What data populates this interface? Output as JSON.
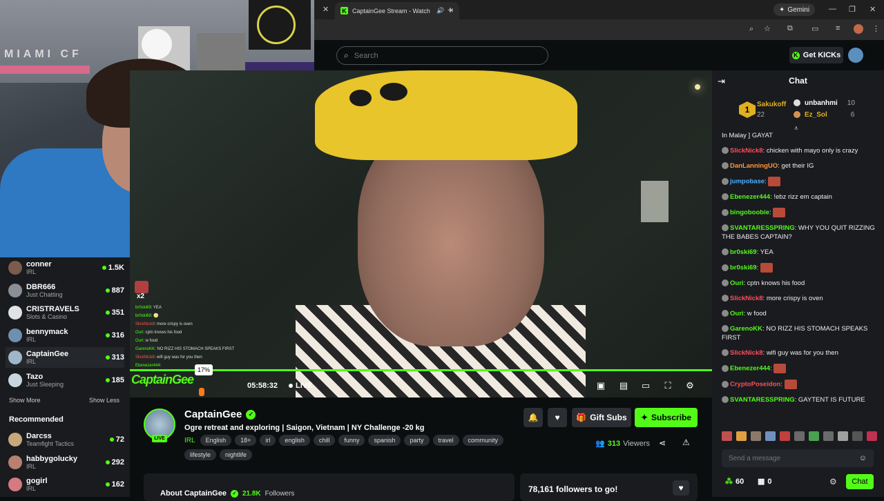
{
  "browser": {
    "tab_title": "CaptainGee Stream - Watch",
    "new_tab": "+",
    "gemini_label": "Gemini",
    "close_tab": "✕",
    "minimize": "—",
    "restore": "❐",
    "close_window": "✕"
  },
  "webcam": {
    "wall_text": "MIAMI CF"
  },
  "header": {
    "search_placeholder": "Search",
    "get_kicks_label": "Get KICKs"
  },
  "video": {
    "overlay_chat": [
      {
        "user": "br0ski69",
        "text": ": YEA",
        "color": "green"
      },
      {
        "user": "br0ski69",
        "text": ": 🌝",
        "color": "green"
      },
      {
        "user": "SlickNick8",
        "text": ": more crispy is oven",
        "color": "red"
      },
      {
        "user": "Ouri",
        "text": ": cptn knows his food",
        "color": "green"
      },
      {
        "user": "Ouri",
        "text": ": w food",
        "color": "green"
      },
      {
        "user": "GarenoKK",
        "text": ": NO RIZZ HIS STOMACH SPEAKS FIRST",
        "color": "green"
      },
      {
        "user": "SlickNick8",
        "text": ": wifi guy was for you then",
        "color": "red"
      },
      {
        "user": "Ebenezer444",
        "text": ":",
        "color": "green"
      }
    ],
    "overlay_multiplier": "x2",
    "overlay_logo": "CaptainGee",
    "volume_tooltip": "17%",
    "elapsed_time": "05:58:32",
    "live_label": "LIVE"
  },
  "sidebar": {
    "channels": [
      {
        "name": "conner",
        "category": "IRL",
        "viewers": "1.5K",
        "color": "#7a5c4c"
      },
      {
        "name": "DBR666",
        "category": "Just Chatting",
        "viewers": "887",
        "color": "#8a8f96"
      },
      {
        "name": "CRISTRAVELS",
        "category": "Slots & Casino",
        "viewers": "351",
        "color": "#dfe3e6"
      },
      {
        "name": "bennymack",
        "category": "IRL",
        "viewers": "316",
        "color": "#6f8fb0"
      },
      {
        "name": "CaptainGee",
        "category": "IRL",
        "viewers": "313",
        "color": "#9fb7c8"
      },
      {
        "name": "Tazo",
        "category": "Just Sleeping",
        "viewers": "185",
        "color": "#c9d6e0"
      }
    ],
    "show_more": "Show More",
    "show_less": "Show Less",
    "recommended_heading": "Recommended",
    "recommended": [
      {
        "name": "Darcss",
        "category": "Teamfight Tactics",
        "viewers": "72",
        "color": "#c8a77a"
      },
      {
        "name": "habbygolucky",
        "category": "IRL",
        "viewers": "292",
        "color": "#b88070"
      },
      {
        "name": "gogirl",
        "category": "IRL",
        "viewers": "162",
        "color": "#d47a80"
      }
    ]
  },
  "stream": {
    "streamer_name": "CaptainGee",
    "title": "Ogre retreat and exploring | Saigon, Vietnam | NY Challenge -20 kg",
    "category": "IRL",
    "tags": [
      "English",
      "18+",
      "irl",
      "english",
      "chill",
      "funny",
      "spanish",
      "party",
      "travel",
      "community",
      "lifestyle",
      "nightlife"
    ],
    "live_badge": "LIVE",
    "viewers_count": "313",
    "viewers_label": "Viewers",
    "gift_subs_label": "Gift Subs",
    "subscribe_label": "Subscribe",
    "about_heading": "About CaptainGee",
    "followers_count": "21.8K",
    "followers_label": "Followers",
    "followers_goal": "78,161 followers to go!"
  },
  "chat": {
    "title": "Chat",
    "top_gifters": [
      {
        "rank": "1",
        "name": "Sakukoff",
        "count": "22"
      },
      {
        "name": "unbanhmi",
        "count": "10"
      },
      {
        "name": "Ez_Sol",
        "count": "6"
      }
    ],
    "messages": [
      {
        "user": "",
        "text": "In Malay ] GAYAT",
        "color": ""
      },
      {
        "user": "SlickNick8",
        "text": ": chicken with mayo only is crazy",
        "color": "red"
      },
      {
        "user": "DanLanningUO",
        "text": ": get their IG",
        "color": "orange"
      },
      {
        "user": "jumpobase",
        "text": ":",
        "color": "blue",
        "emote": true
      },
      {
        "user": "Ebenezer444",
        "text": ": !ebz rizz em captain",
        "color": "green"
      },
      {
        "user": "bingoboobie",
        "text": ":",
        "color": "green",
        "emote": true
      },
      {
        "user": "SVANTARESSPRING",
        "text": ": WHY YOU QUIT RIZZING THE BABES CAPTAIN?",
        "color": "green"
      },
      {
        "user": "br0ski69",
        "text": ": YEA",
        "color": "green"
      },
      {
        "user": "br0ski69",
        "text": ":",
        "color": "green",
        "emote": true
      },
      {
        "user": "Ouri",
        "text": ": cptn knows his food",
        "color": "green"
      },
      {
        "user": "SlickNick8",
        "text": ": more crispy is oven",
        "color": "red"
      },
      {
        "user": "Ouri",
        "text": ": w food",
        "color": "green"
      },
      {
        "user": "GarenoKK",
        "text": ": NO RIZZ HIS STOMACH SPEAKS FIRST",
        "color": "green"
      },
      {
        "user": "SlickNick8",
        "text": ": wifi guy was for you then",
        "color": "red"
      },
      {
        "user": "Ebenezer444",
        "text": ":",
        "color": "green",
        "emote": true
      },
      {
        "user": "CryptoPoseidon",
        "text": ":",
        "color": "red",
        "emote": true
      },
      {
        "user": "SVANTARESSPRING",
        "text": ": GAYTENT IS FUTURE",
        "color": "green"
      }
    ],
    "input_placeholder": "Send a message",
    "kicks_count": "60",
    "second_count": "0",
    "send_label": "Chat"
  },
  "colors": {
    "accent": "#53fc18",
    "background": "#0b0e0f",
    "panel": "#191b1f"
  }
}
